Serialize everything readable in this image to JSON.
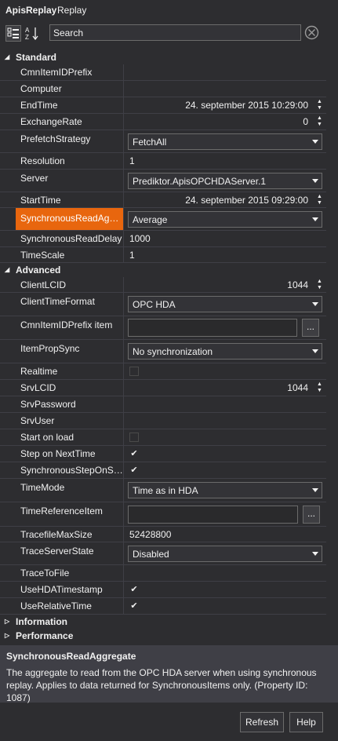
{
  "title": {
    "primary": "ApisReplay",
    "secondary": "Replay"
  },
  "toolbar": {
    "categorized_icon": "categorized-icon",
    "alphabetical_icon": "alphabetical-sort-icon",
    "search_placeholder": "Search",
    "clear_icon": "clear-icon"
  },
  "categories": {
    "standard": {
      "label": "Standard",
      "rows": [
        {
          "name": "CmnItemIDPrefix",
          "value": ""
        },
        {
          "name": "Computer",
          "value": ""
        },
        {
          "name": "EndTime",
          "value": "24. september 2015 10:29:00"
        },
        {
          "name": "ExchangeRate",
          "value": "0"
        },
        {
          "name": "PrefetchStrategy",
          "value": "FetchAll"
        },
        {
          "name": "Resolution",
          "value": "1"
        },
        {
          "name": "Server",
          "value": "Prediktor.ApisOPCHDAServer.1"
        },
        {
          "name": "StartTime",
          "value": "24. september 2015 09:29:00"
        },
        {
          "name": "SynchronousReadAggr...",
          "value": "Average"
        },
        {
          "name": "SynchronousReadDelay",
          "value": "1000"
        },
        {
          "name": "TimeScale",
          "value": "1"
        }
      ]
    },
    "advanced": {
      "label": "Advanced",
      "rows": [
        {
          "name": "ClientLCID",
          "value": "1044"
        },
        {
          "name": "ClientTimeFormat",
          "value": "OPC HDA"
        },
        {
          "name": "CmnItemIDPrefix item",
          "value": "",
          "ellipsis": "..."
        },
        {
          "name": "ItemPropSync",
          "value": "No synchronization"
        },
        {
          "name": "Realtime",
          "checked": false
        },
        {
          "name": "SrvLCID",
          "value": "1044"
        },
        {
          "name": "SrvPassword",
          "value": ""
        },
        {
          "name": "SrvUser",
          "value": ""
        },
        {
          "name": "Start on load",
          "checked": false
        },
        {
          "name": "Step on NextTime",
          "checked": true
        },
        {
          "name": "SynchronousStepOnSt...",
          "checked": true
        },
        {
          "name": "TimeMode",
          "value": "Time as in HDA"
        },
        {
          "name": "TimeReferenceItem",
          "value": "",
          "ellipsis": "..."
        },
        {
          "name": "TracefileMaxSize",
          "value": "52428800"
        },
        {
          "name": "TraceServerState",
          "value": "Disabled"
        },
        {
          "name": "TraceToFile",
          "value": ""
        },
        {
          "name": "UseHDATimestamp",
          "checked": true
        },
        {
          "name": "UseRelativeTime",
          "checked": true
        }
      ]
    },
    "information": {
      "label": "Information"
    },
    "performance": {
      "label": "Performance"
    }
  },
  "checkmark": "✔",
  "help": {
    "title": "SynchronousReadAggregate",
    "description": "The aggregate to read from the OPC HDA server when using synchronous replay. Applies to data returned for SynchronousItems only. (Property ID: 1087)"
  },
  "buttons": {
    "refresh": "Refresh",
    "help": "Help"
  },
  "colors": {
    "background": "#2d2d30",
    "selection": "#e8660e",
    "help_panel": "#3f3f46",
    "text": "#f1f1f1"
  }
}
